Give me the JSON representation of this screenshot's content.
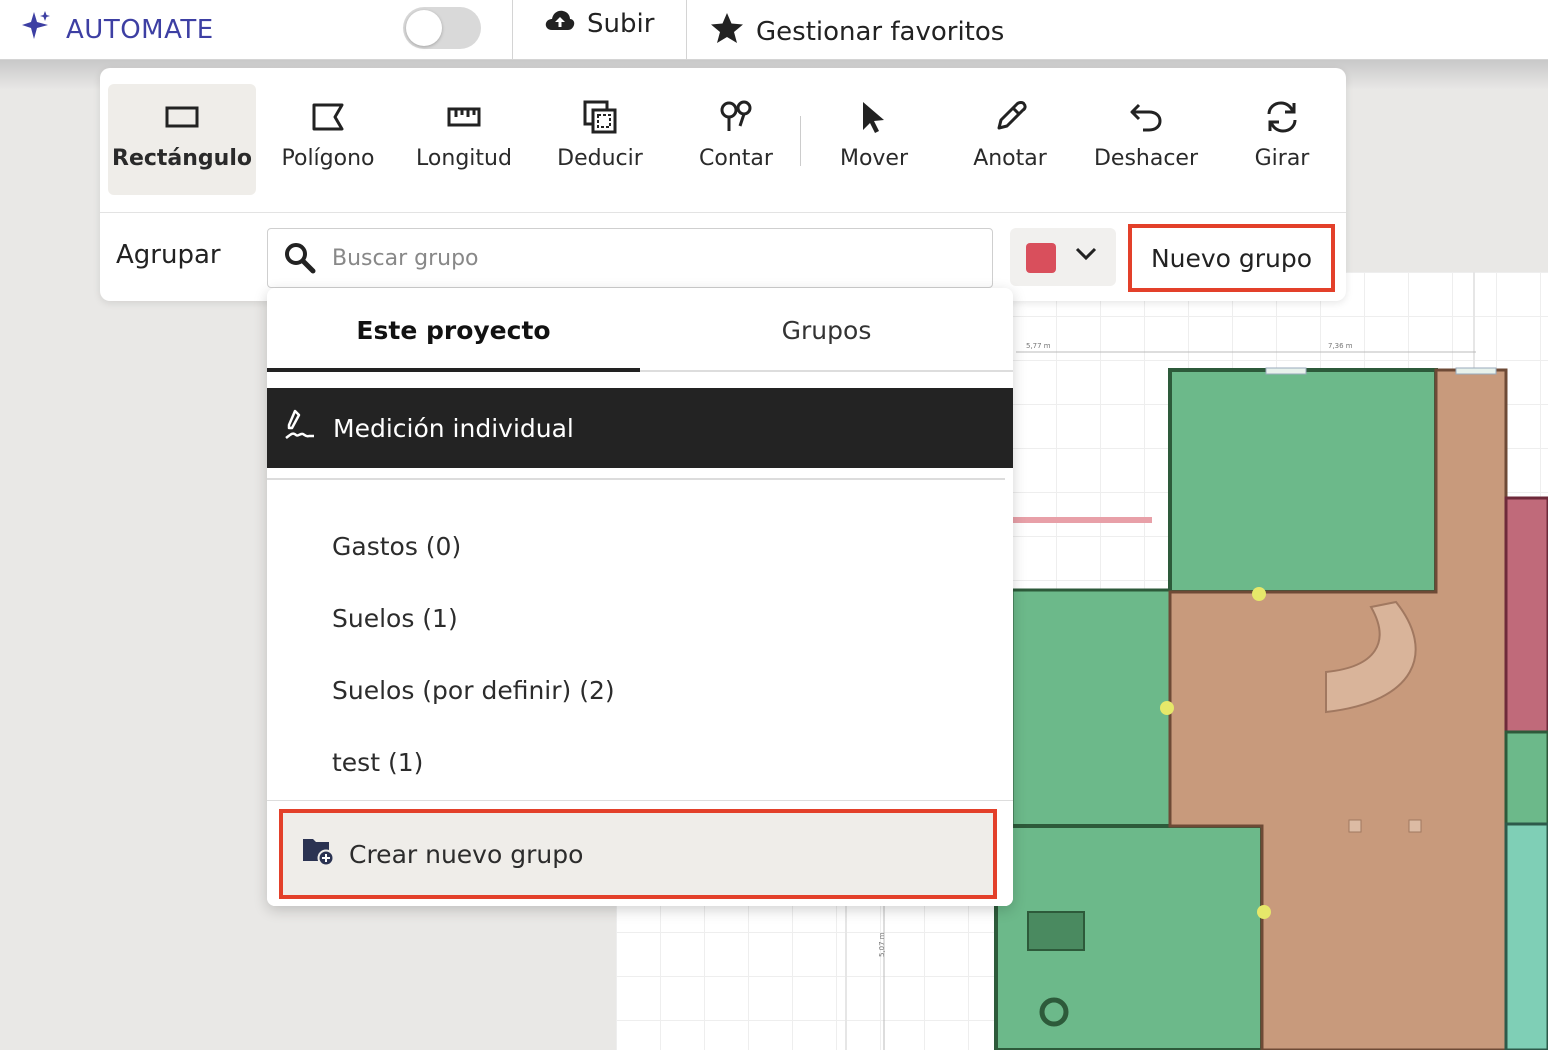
{
  "topbar": {
    "automate_label": "AUTOMATE",
    "toggle_on": false,
    "upload_label": "Subir",
    "favorites_label": "Gestionar favoritos"
  },
  "tools": {
    "rectangle": "Rectángulo",
    "polygon": "Polígono",
    "length": "Longitud",
    "deduct": "Deducir",
    "count": "Contar",
    "move": "Mover",
    "annotate": "Anotar",
    "undo": "Deshacer",
    "rotate": "Girar",
    "active_tool": "Rectángulo"
  },
  "group_bar": {
    "label": "Agrupar",
    "search_placeholder": "Buscar grupo",
    "search_value": "",
    "selected_color": "#d94f5c",
    "new_group_label": "Nuevo grupo"
  },
  "dropdown": {
    "tabs": [
      "Este proyecto",
      "Grupos"
    ],
    "active_tab": "Este proyecto",
    "individual_label": "Medición individual",
    "groups": [
      "Gastos (0)",
      "Suelos (1)",
      "Suelos (por definir) (2)",
      "test (1)"
    ],
    "create_label": "Crear nuevo grupo"
  },
  "plan": {
    "dimension_labels": [
      "5,77 m",
      "7,36 m",
      "5,07 m"
    ]
  },
  "colors": {
    "accent": "#3d3fa3",
    "highlight": "#e3402a",
    "room_green": "#6cb98a",
    "room_brown": "#c89a7c",
    "room_red": "#c06a7a",
    "room_teal": "#7fcfb6"
  }
}
